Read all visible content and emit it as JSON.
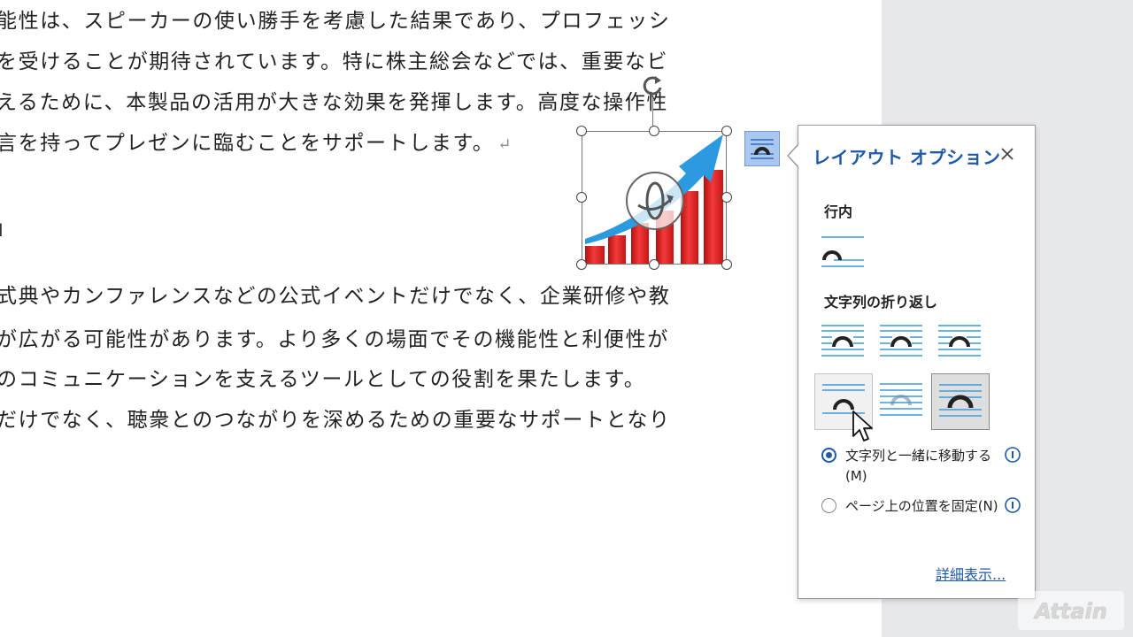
{
  "document": {
    "lines": [
      "能性は、スピーカーの使い勝手を考慮した結果であり、プロフェッシ",
      "を受けることが期待されています。特に株主総会などでは、重要なビ",
      "えるために、本製品の活用が大きな効果を発揮します。高度な操作性",
      "言を持ってプレゼンに臨むことをサポートします。",
      "式典やカンファレンスなどの公式イベントだけでなく、企業研修や教",
      "が広がる可能性があります。より多くの場面でその機能性と利便性が",
      "のコミュニケーションを支えるツールとしての役割を果たします。",
      "だけでなく、聴衆とのつながりを深めるための重要なサポートとなり"
    ],
    "paragraph_mark": "↵",
    "bracket": "」"
  },
  "layout_panel": {
    "title": "レイアウト オプション",
    "inline_label": "行内",
    "wrap_label": "文字列の折り返し",
    "radio_move": "文字列と一緒に移動する(M)",
    "radio_fix": "ページ上の位置を固定(N)",
    "more_link": "詳細表示...",
    "selected_radio": "move_with_text"
  },
  "watermark": "Attain",
  "colors": {
    "accent": "#1f5aa6",
    "wrap_line": "#3a9ad9",
    "bar_red": "#e02020",
    "arrow_blue": "#2b9ae0"
  },
  "icons": {
    "close": "close-icon",
    "info": "info-icon",
    "rotate": "rotate-icon",
    "layout_options": "layout-options-icon"
  }
}
